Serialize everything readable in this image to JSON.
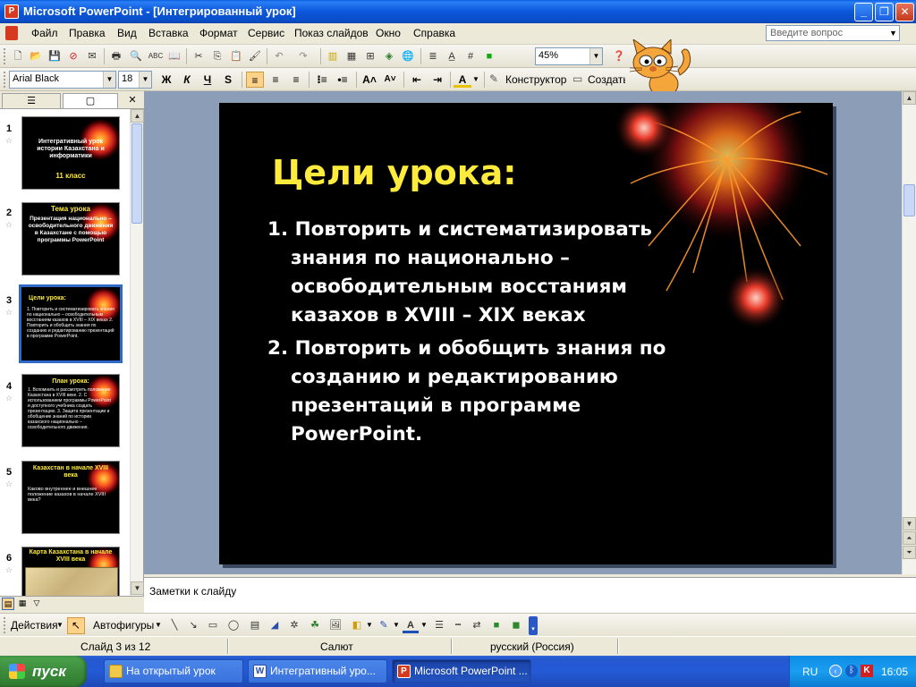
{
  "window": {
    "title": "Microsoft PowerPoint - [Интегрированный урок]",
    "app_icon": "powerpoint-icon"
  },
  "menu": {
    "items": [
      "Файл",
      "Правка",
      "Вид",
      "Вставка",
      "Формат",
      "Сервис",
      "Показ слайдов",
      "Окно",
      "Справка"
    ],
    "ask_placeholder": "Введите вопрос"
  },
  "toolbar_standard": {
    "zoom": "45%"
  },
  "toolbar_format": {
    "font": "Arial Black",
    "size": "18",
    "bold": "Ж",
    "italic": "К",
    "underline": "Ч",
    "shadow": "S",
    "designer": "Конструктор",
    "new_slide": "Создать слайд"
  },
  "thumbnails": [
    {
      "num": "1",
      "title": "Интегративный урок истории Казахстана и информатики",
      "sub": "11 класс"
    },
    {
      "num": "2",
      "title": "Тема урока",
      "sub": "Презентация национально – освободительного движения в Казахстане с помощью программы PowerPoint"
    },
    {
      "num": "3",
      "title": "Цели урока:",
      "sub": "1. Повторить и систематизировать знания по национально – освободительным восстаниям казахов в XVIII – XIX веках 2. Повторить и обобщить знания по созданию и редактированию презентаций в программе PowerPoint."
    },
    {
      "num": "4",
      "title": "План урока:",
      "sub": "1. Вспомнить и рассмотреть положение Казахстана в XVIII веке. 2. С использованием программы PowerPoint и доступного учебника создать презентацию. 3. Защита презентации и обобщение знаний по истории казахского национально – освободительного движения."
    },
    {
      "num": "5",
      "title": "Казахстан в начале XVIII века",
      "sub": "Каково внутреннее и внешнее положение казахов в начале XVIII века?"
    },
    {
      "num": "6",
      "title": "Карта Казахстана в начале XVIII века",
      "sub": ""
    }
  ],
  "slide": {
    "title": "Цели урока:",
    "bullets": [
      {
        "lines": [
          "1. Повторить и систематизировать",
          "знания по национально –",
          "освободительным восстаниям",
          "казахов в XVIII – XIX веках"
        ]
      },
      {
        "lines": [
          "2. Повторить и обобщить знания по",
          "созданию и редактированию",
          "презентаций в программе",
          "PowerPoint."
        ]
      }
    ]
  },
  "notes": {
    "placeholder": "Заметки к слайду"
  },
  "drawing": {
    "actions": "Действия",
    "autoshapes": "Автофигуры"
  },
  "status": {
    "slide": "Слайд 3 из 12",
    "design": "Салют",
    "language": "русский (Россия)"
  },
  "taskbar": {
    "start": "пуск",
    "tasks": [
      {
        "label": "На открытый урок",
        "icon": "folder-icon"
      },
      {
        "label": "Интегративный уро...",
        "icon": "word-icon"
      },
      {
        "label": "Microsoft PowerPoint ...",
        "icon": "powerpoint-icon"
      }
    ],
    "lang": "RU",
    "clock": "16:05"
  },
  "colors": {
    "slide_title": "#ffeb3b",
    "slide_bg": "#000000",
    "workspace": "#8c9db8",
    "xp_blue": "#0b56db"
  }
}
